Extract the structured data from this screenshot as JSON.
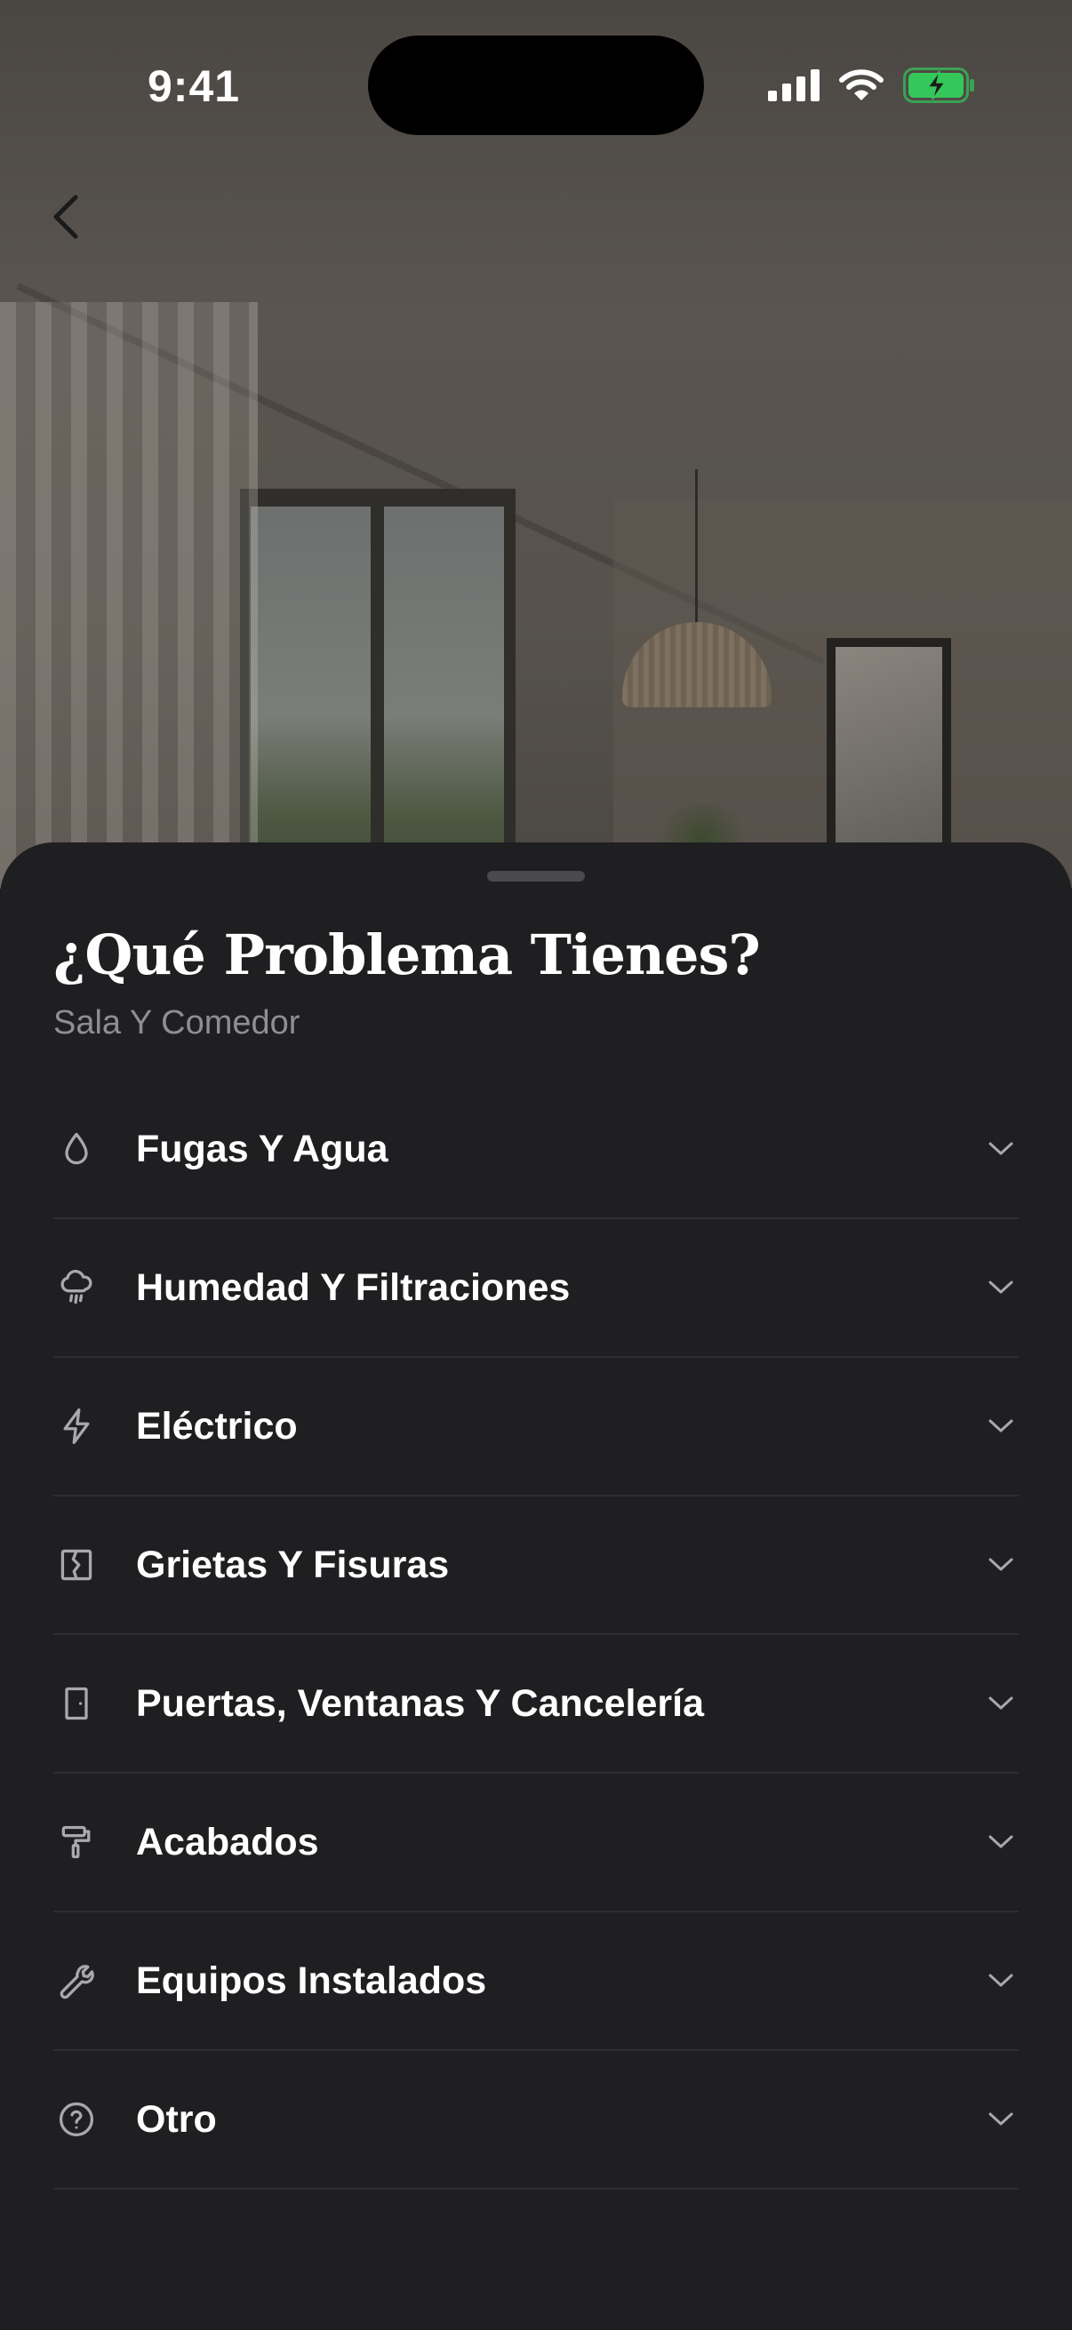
{
  "status_bar": {
    "time": "9:41",
    "icons": [
      "signal-icon",
      "wifi-icon",
      "battery-charging-icon"
    ],
    "battery_color": "#34c759"
  },
  "navigation": {
    "back_icon": "chevron-left-icon"
  },
  "sheet": {
    "title": "¿Qué Problema Tienes?",
    "subtitle": "Sala Y Comedor",
    "categories": [
      {
        "label": "Fugas Y Agua",
        "icon": "water-drop-icon"
      },
      {
        "label": "Humedad Y Filtraciones",
        "icon": "cloud-rain-icon"
      },
      {
        "label": "Eléctrico",
        "icon": "lightning-icon"
      },
      {
        "label": "Grietas Y Fisuras",
        "icon": "crack-icon"
      },
      {
        "label": "Puertas, Ventanas Y Cancelería",
        "icon": "door-icon"
      },
      {
        "label": "Acabados",
        "icon": "paint-roller-icon"
      },
      {
        "label": "Equipos Instalados",
        "icon": "wrench-icon"
      },
      {
        "label": "Otro",
        "icon": "question-circle-icon"
      }
    ],
    "expand_icon": "chevron-down-icon"
  },
  "colors": {
    "sheet_background": "#1f1f21",
    "primary_text": "#ffffff",
    "secondary_text": "#8e8e93",
    "divider": "#2e2e31"
  }
}
